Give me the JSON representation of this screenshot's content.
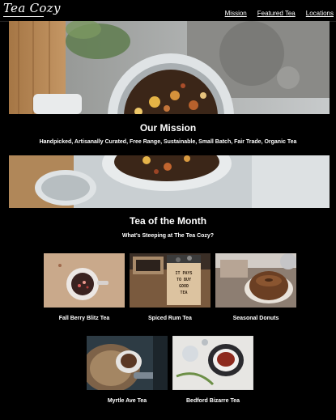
{
  "header": {
    "logo_text": "Tea Cozy",
    "nav": [
      "Mission",
      "Featured Tea",
      "Locations"
    ]
  },
  "mission": {
    "title": "Our Mission",
    "subtitle": "Handpicked, Artisanally Curated, Free Range, Sustainable, Small Batch, Fair Trade, Organic Tea"
  },
  "tea_of_month": {
    "title": "Tea of the Month",
    "subtitle": "What's Steeping at The Tea Cozy?",
    "items": [
      {
        "name": "Fall Berry Blitz Tea"
      },
      {
        "name": "Spiced Rum Tea"
      },
      {
        "name": "Seasonal Donuts"
      },
      {
        "name": "Myrtle Ave Tea"
      },
      {
        "name": "Bedford Bizarre Tea"
      }
    ]
  },
  "box_text": "IT PAYS TO BUY GOOD TEA",
  "colors": {
    "background": "#000000",
    "text": "#ffffff"
  }
}
